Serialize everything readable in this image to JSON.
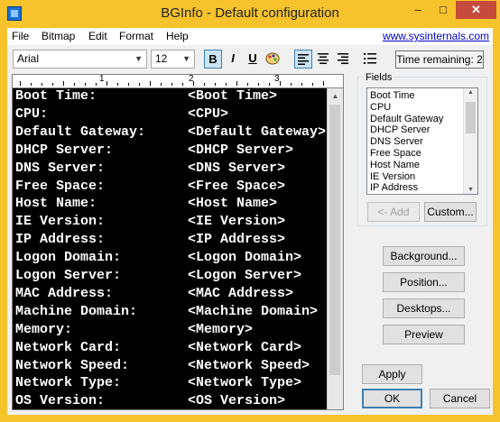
{
  "window": {
    "title": "BGInfo - Default configuration"
  },
  "titlebar": {
    "minimize": "–",
    "maximize": "□",
    "close": "✕"
  },
  "menu": [
    "File",
    "Bitmap",
    "Edit",
    "Format",
    "Help"
  ],
  "site_link": "www.sysinternals.com",
  "toolbar": {
    "font": "Arial",
    "size": "12",
    "bold": "B",
    "italic": "I",
    "underline": "U",
    "time_remaining": "Time remaining: 2",
    "icons": [
      "bold-icon",
      "italic-icon",
      "underline-icon",
      "color-palette-icon",
      "align-left-icon",
      "align-center-icon",
      "align-right-icon",
      "bullet-list-icon"
    ]
  },
  "ruler": {
    "numbers": [
      "1",
      "2",
      "3"
    ]
  },
  "editor": {
    "lines": [
      {
        "label": "Boot Time:",
        "value": "<Boot Time>"
      },
      {
        "label": "CPU:",
        "value": "<CPU>"
      },
      {
        "label": "Default Gateway:",
        "value": "<Default Gateway>"
      },
      {
        "label": "DHCP Server:",
        "value": "<DHCP Server>"
      },
      {
        "label": "DNS Server:",
        "value": "<DNS Server>"
      },
      {
        "label": "Free Space:",
        "value": "<Free Space>"
      },
      {
        "label": "Host Name:",
        "value": "<Host Name>"
      },
      {
        "label": "IE Version:",
        "value": "<IE Version>"
      },
      {
        "label": "IP Address:",
        "value": "<IP Address>"
      },
      {
        "label": "Logon Domain:",
        "value": "<Logon Domain>"
      },
      {
        "label": "Logon Server:",
        "value": "<Logon Server>"
      },
      {
        "label": "MAC Address:",
        "value": "<MAC Address>"
      },
      {
        "label": "Machine Domain:",
        "value": "<Machine Domain>"
      },
      {
        "label": "Memory:",
        "value": "<Memory>"
      },
      {
        "label": "Network Card:",
        "value": "<Network Card>"
      },
      {
        "label": "Network Speed:",
        "value": "<Network Speed>"
      },
      {
        "label": "Network Type:",
        "value": "<Network Type>"
      },
      {
        "label": "OS Version:",
        "value": "<OS Version>"
      }
    ]
  },
  "fields": {
    "caption": "Fields",
    "items": [
      "Boot Time",
      "CPU",
      "Default Gateway",
      "DHCP Server",
      "DNS Server",
      "Free Space",
      "Host Name",
      "IE Version",
      "IP Address"
    ]
  },
  "buttons": {
    "add": "<- Add",
    "custom": "Custom...",
    "background": "Background...",
    "position": "Position...",
    "desktops": "Desktops...",
    "preview": "Preview",
    "apply": "Apply",
    "ok": "OK",
    "cancel": "Cancel"
  }
}
